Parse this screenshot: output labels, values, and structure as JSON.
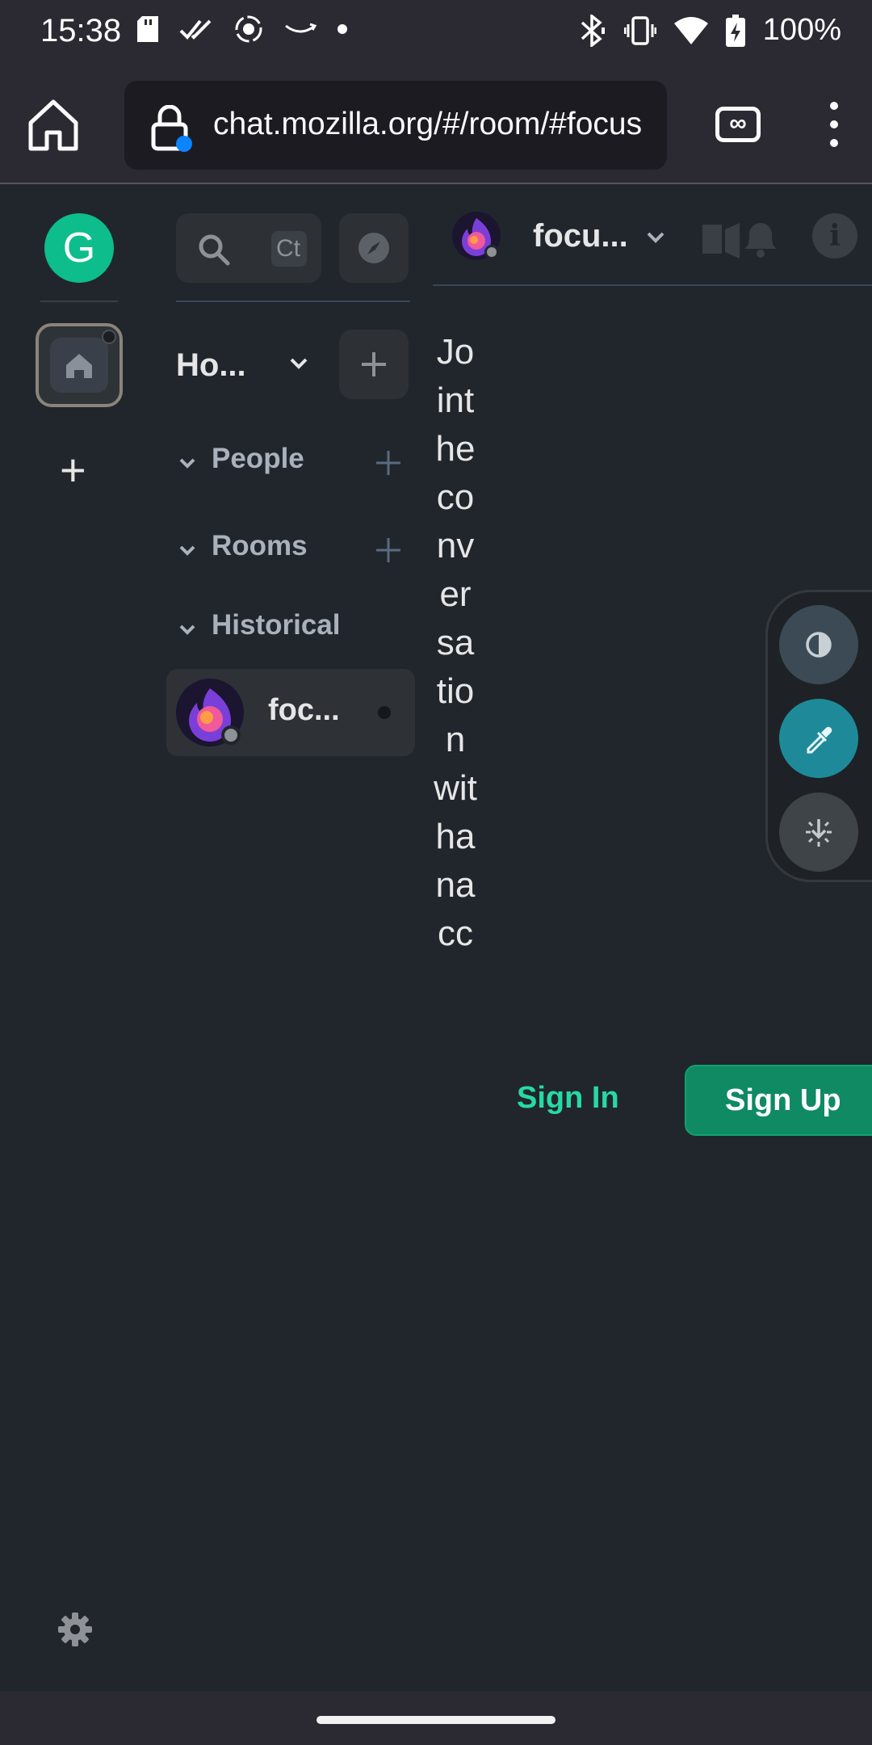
{
  "status_bar": {
    "time": "15:38",
    "battery": "100%"
  },
  "browser": {
    "url": "chat.mozilla.org/#/room/#focus",
    "tabs_count": "∞"
  },
  "space_bar": {
    "user_initial": "G"
  },
  "room_list": {
    "search_shortcut": "Ct",
    "home_label": "Ho...",
    "sections": {
      "people": "People",
      "rooms": "Rooms",
      "historical": "Historical"
    },
    "room_tile_name": "foc..."
  },
  "main": {
    "room_name": "focu...",
    "join_text": "Jointheconversationwithanacc",
    "sign_in": "Sign In",
    "sign_up": "Sign Up"
  },
  "colors": {
    "accent": "#0dbd8b",
    "sign_in": "#26d9a5",
    "sign_up_bg": "#0f8a62",
    "tool_pen": "#1e8a99"
  }
}
